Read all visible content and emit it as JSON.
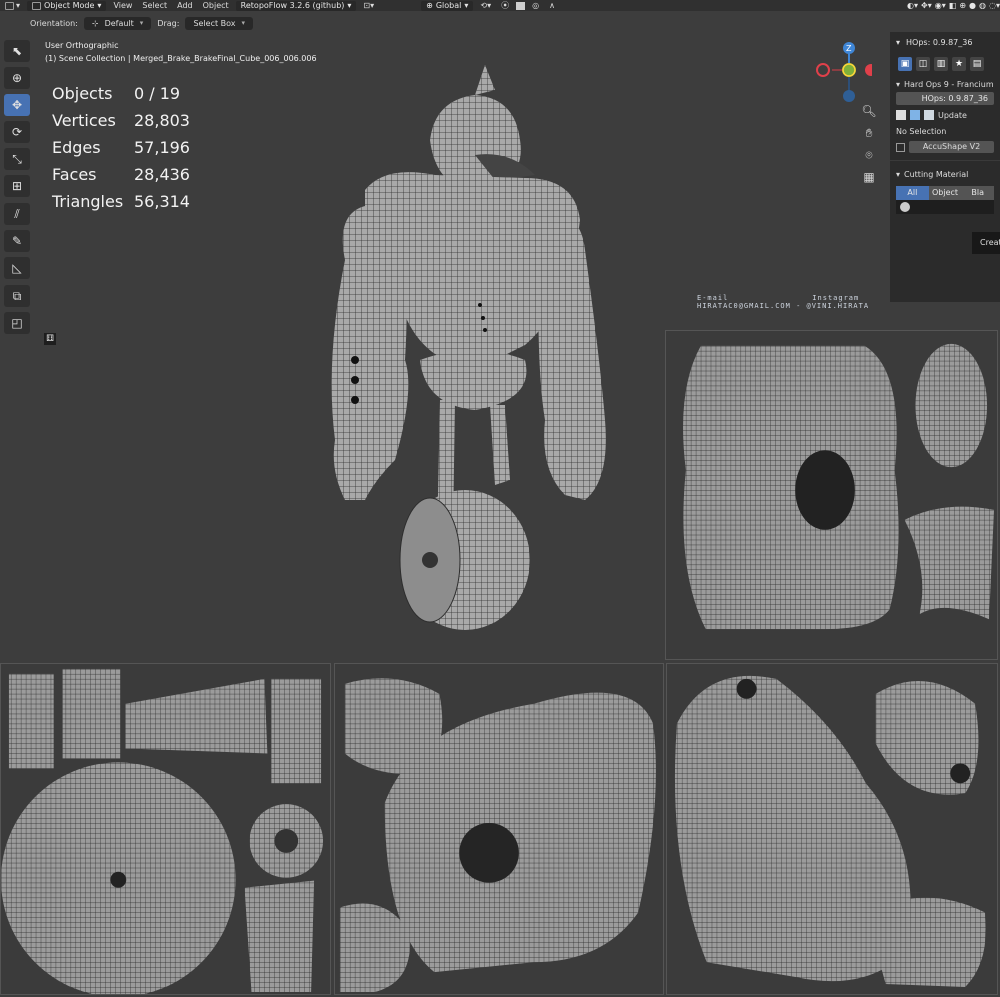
{
  "topbar": {
    "mode": "Object Mode",
    "menus": [
      "View",
      "Select",
      "Add",
      "Object"
    ],
    "addon": "RetopoFlow 3.2.6 (github)",
    "transform_orientation": "Global"
  },
  "header2": {
    "orientation_label": "Orientation:",
    "orientation_value": "Default",
    "drag_label": "Drag:",
    "drag_value": "Select Box"
  },
  "viewport": {
    "view_name": "User Orthographic",
    "collection": "(1) Scene Collection | Merged_Brake_BrakeFinal_Cube_006_006.006"
  },
  "stats": [
    {
      "key": "Objects",
      "value": "0 / 19"
    },
    {
      "key": "Vertices",
      "value": "28,803"
    },
    {
      "key": "Edges",
      "value": "57,196"
    },
    {
      "key": "Faces",
      "value": "28,436"
    },
    {
      "key": "Triangles",
      "value": "56,314"
    }
  ],
  "gizmo": {
    "z_label": "Z",
    "colors": {
      "x": "#e0404a",
      "y": "#7fb13a",
      "z": "#3f86d6"
    }
  },
  "credits": {
    "email_label": "E-mail",
    "instagram_label": "Instagram",
    "line": "HIRATAC0@GMAIL.COM - @VINI.HIRATA"
  },
  "npanel": {
    "header": "HOps: 0.9.87_36",
    "title_row": "Hard Ops 9 - Francium",
    "version_field": "HOps: 0.9.87_36",
    "update_label": "Update",
    "selection": "No Selection",
    "accushape": "AccuShape V2",
    "cutting_material": "Cutting Material",
    "tabs": [
      "All",
      "Object",
      "Bla"
    ],
    "tooltip": "Creat"
  },
  "colors": {
    "accent": "#4772b3",
    "background": "#3d3d3d",
    "panel": "#2b2b2b"
  }
}
